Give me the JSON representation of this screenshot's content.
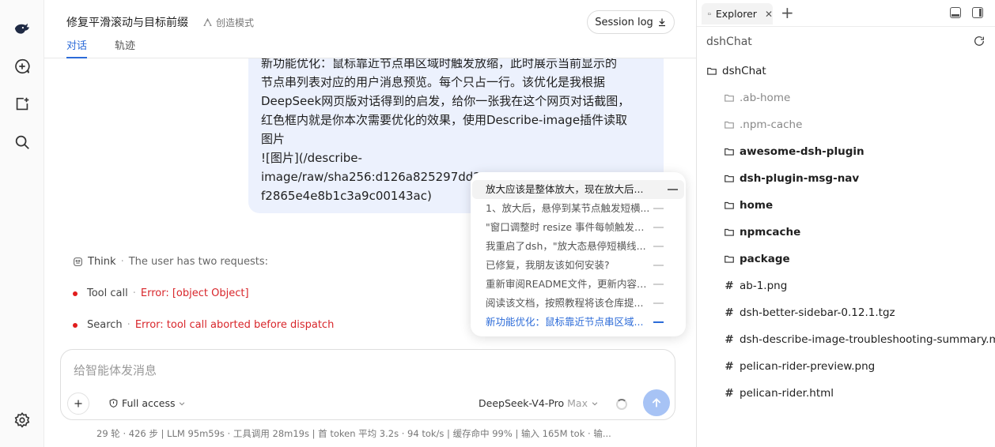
{
  "rail": {
    "icons": [
      "whale-logo-icon",
      "new-chat-icon",
      "new-item-icon",
      "search-icon",
      "settings-icon"
    ]
  },
  "header": {
    "title": "修复平滑滚动与目标前缀",
    "mode": "创造模式",
    "tabs": [
      "对话",
      "轨迹"
    ],
    "session_log": "Session log"
  },
  "bubble": {
    "lines": [
      "新功能优化：鼠标靠近节点串区域时触发放缩，此时展示当前显示的",
      "节点串列表对应的用户消息预览。每个只占一行。该优化是我根据",
      "DeepSeek网页版对话得到的启发，给你一张我在这个网页对话截图，",
      "红色框内就是你本次需要优化的效果，使用Describe-image插件读取",
      "图片",
      "![图片](/describe-",
      "image/raw/sha256:d126a825297dd29c",
      "f2865e4e8b1c3a9c00143ac)"
    ]
  },
  "events": {
    "think_label": "Think",
    "think_text": "The user has two requests:",
    "toolcall_label": "Tool call",
    "toolcall_error": "Error: [object Object]",
    "search_label": "Search",
    "search_error": "Error: tool call aborted before dispatch",
    "separator": "·"
  },
  "popover": {
    "items": [
      "放大应该是整体放大，现在放大后...",
      "1、放大后，悬停到某节点触发短横...",
      "\"窗口调整时 resize 事件每帧触发完...",
      "我重启了dsh，\"放大态悬停短横线...",
      "已修复，我朋友该如何安装?",
      "重新审阅README文件，更新内容，...",
      "阅读该文档，按照教程将该仓库提...",
      "新功能优化：鼠标靠近节点串区域..."
    ],
    "active_index": 7
  },
  "composer": {
    "placeholder": "给智能体发消息",
    "access": "Full access",
    "model": "DeepSeek-V4-Pro",
    "model_tier": "Max"
  },
  "stats": "29 轮 · 426 步   |   LLM 95m59s · 工具调用 28m19s   |   首 token 平均 3.2s · 94 tok/s   |   缓存命中 99%   |   输入 165M tok · 输...",
  "explorer": {
    "tab_label": "Explorer",
    "root": "dshChat",
    "tree": [
      {
        "name": "dshChat",
        "kind": "folder",
        "depth": 0,
        "style": "normal"
      },
      {
        "name": ".ab-home",
        "kind": "folder",
        "depth": 1,
        "style": "dim"
      },
      {
        "name": ".npm-cache",
        "kind": "folder",
        "depth": 1,
        "style": "dim"
      },
      {
        "name": "awesome-dsh-plugin",
        "kind": "folder",
        "depth": 1,
        "style": "bold"
      },
      {
        "name": "dsh-plugin-msg-nav",
        "kind": "folder",
        "depth": 1,
        "style": "bold"
      },
      {
        "name": "home",
        "kind": "folder",
        "depth": 1,
        "style": "bold"
      },
      {
        "name": "npmcache",
        "kind": "folder",
        "depth": 1,
        "style": "bold"
      },
      {
        "name": "package",
        "kind": "folder",
        "depth": 1,
        "style": "bold"
      },
      {
        "name": "ab-1.png",
        "kind": "file",
        "depth": 1,
        "style": "normal"
      },
      {
        "name": "dsh-better-sidebar-0.12.1.tgz",
        "kind": "file",
        "depth": 1,
        "style": "normal"
      },
      {
        "name": "dsh-describe-image-troubleshooting-summary.md",
        "kind": "file",
        "depth": 1,
        "style": "normal"
      },
      {
        "name": "pelican-rider-preview.png",
        "kind": "file",
        "depth": 1,
        "style": "normal"
      },
      {
        "name": "pelican-rider.html",
        "kind": "file",
        "depth": 1,
        "style": "normal"
      }
    ]
  },
  "colors": {
    "accent": "#2c6bd8",
    "error": "#d8262b",
    "bubble_bg": "#ecf1fd",
    "send_button": "#a7c3f5"
  }
}
